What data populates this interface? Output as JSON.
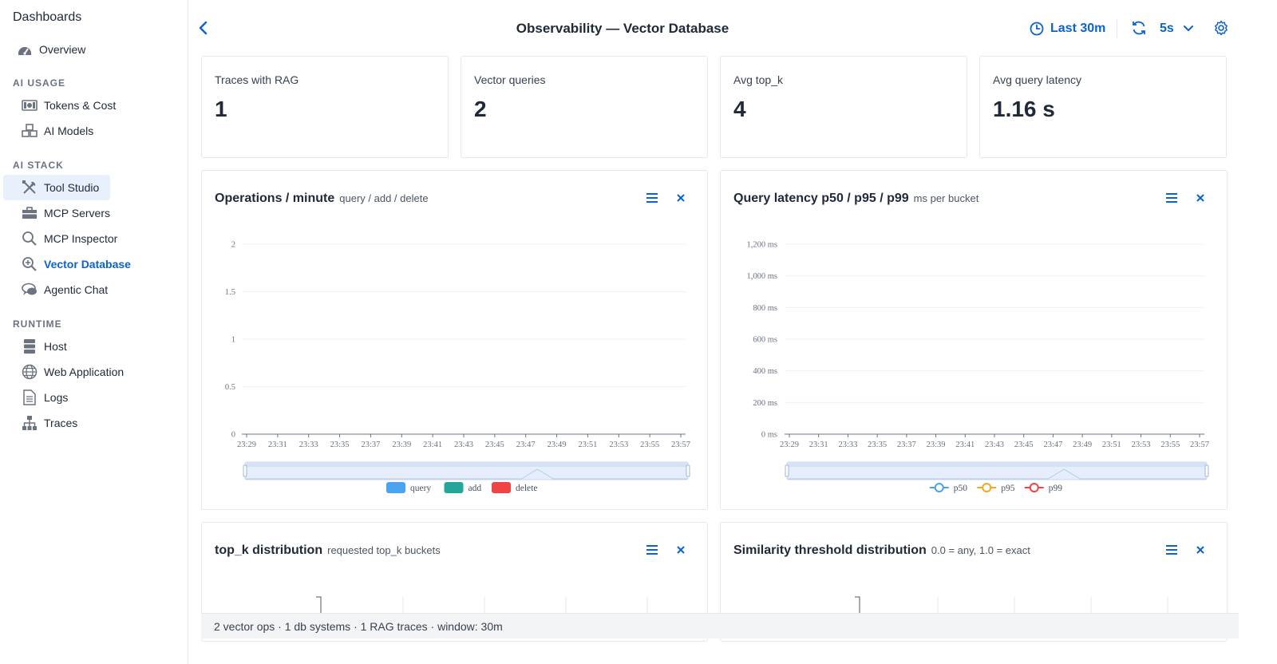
{
  "sidebar": {
    "title": "Dashboards",
    "overview": "Overview",
    "sections": {
      "ai_usage": "AI USAGE",
      "ai_stack": "AI STACK",
      "runtime": "RUNTIME"
    },
    "items": {
      "tokens": "Tokens & Cost",
      "models": "AI Models",
      "tool_studio": "Tool Studio",
      "mcp_servers": "MCP Servers",
      "mcp_inspector": "MCP Inspector",
      "vector_db": "Vector Database",
      "agentic_chat": "Agentic Chat",
      "host": "Host",
      "web_app": "Web Application",
      "logs": "Logs",
      "traces": "Traces"
    }
  },
  "header": {
    "title": "Observability — Vector Database",
    "time_range": "Last 30m",
    "refresh_interval": "5s"
  },
  "stats": [
    {
      "label": "Traces with RAG",
      "value": "1"
    },
    {
      "label": "Vector queries",
      "value": "2"
    },
    {
      "label": "Avg top_k",
      "value": "4"
    },
    {
      "label": "Avg query latency",
      "value": "1.16 s"
    }
  ],
  "panels": {
    "ops": {
      "title": "Operations / minute",
      "subtitle": "query / add / delete"
    },
    "latency": {
      "title": "Query latency p50 / p95 / p99",
      "subtitle": "ms per bucket"
    },
    "topk": {
      "title": "top_k distribution",
      "subtitle": "requested top_k buckets"
    },
    "similarity": {
      "title": "Similarity threshold distribution",
      "subtitle": "0.0 = any, 1.0 = exact"
    }
  },
  "chart_data": [
    {
      "type": "bar",
      "categories": [
        "23:29",
        "23:31",
        "23:33",
        "23:35",
        "23:37",
        "23:39",
        "23:41",
        "23:43",
        "23:45",
        "23:47",
        "23:49",
        "23:51",
        "23:53",
        "23:55",
        "23:57"
      ],
      "y_ticks": [
        "0",
        "0.5",
        "1",
        "1.5",
        "2"
      ],
      "ylim": [
        0,
        2
      ],
      "grid": true,
      "legend_position": "bottom",
      "series": [
        {
          "name": "query",
          "color": "#4aa3f0"
        },
        {
          "name": "add",
          "color": "#26a69a"
        },
        {
          "name": "delete",
          "color": "#ef4444"
        }
      ]
    },
    {
      "type": "line",
      "categories": [
        "23:29",
        "23:31",
        "23:33",
        "23:35",
        "23:37",
        "23:39",
        "23:41",
        "23:43",
        "23:45",
        "23:47",
        "23:49",
        "23:51",
        "23:53",
        "23:55",
        "23:57"
      ],
      "y_ticks": [
        "0 ms",
        "200 ms",
        "400 ms",
        "600 ms",
        "800 ms",
        "1,000 ms",
        "1,200 ms"
      ],
      "ylim": [
        0,
        1200
      ],
      "grid": true,
      "legend_position": "bottom",
      "series": [
        {
          "name": "p50",
          "color": "#4aa3f0"
        },
        {
          "name": "p95",
          "color": "#f5a623"
        },
        {
          "name": "p99",
          "color": "#ef4444"
        }
      ]
    }
  ],
  "footer": {
    "summary": "2 vector ops · 1 db systems · 1 RAG traces · window: 30m"
  }
}
